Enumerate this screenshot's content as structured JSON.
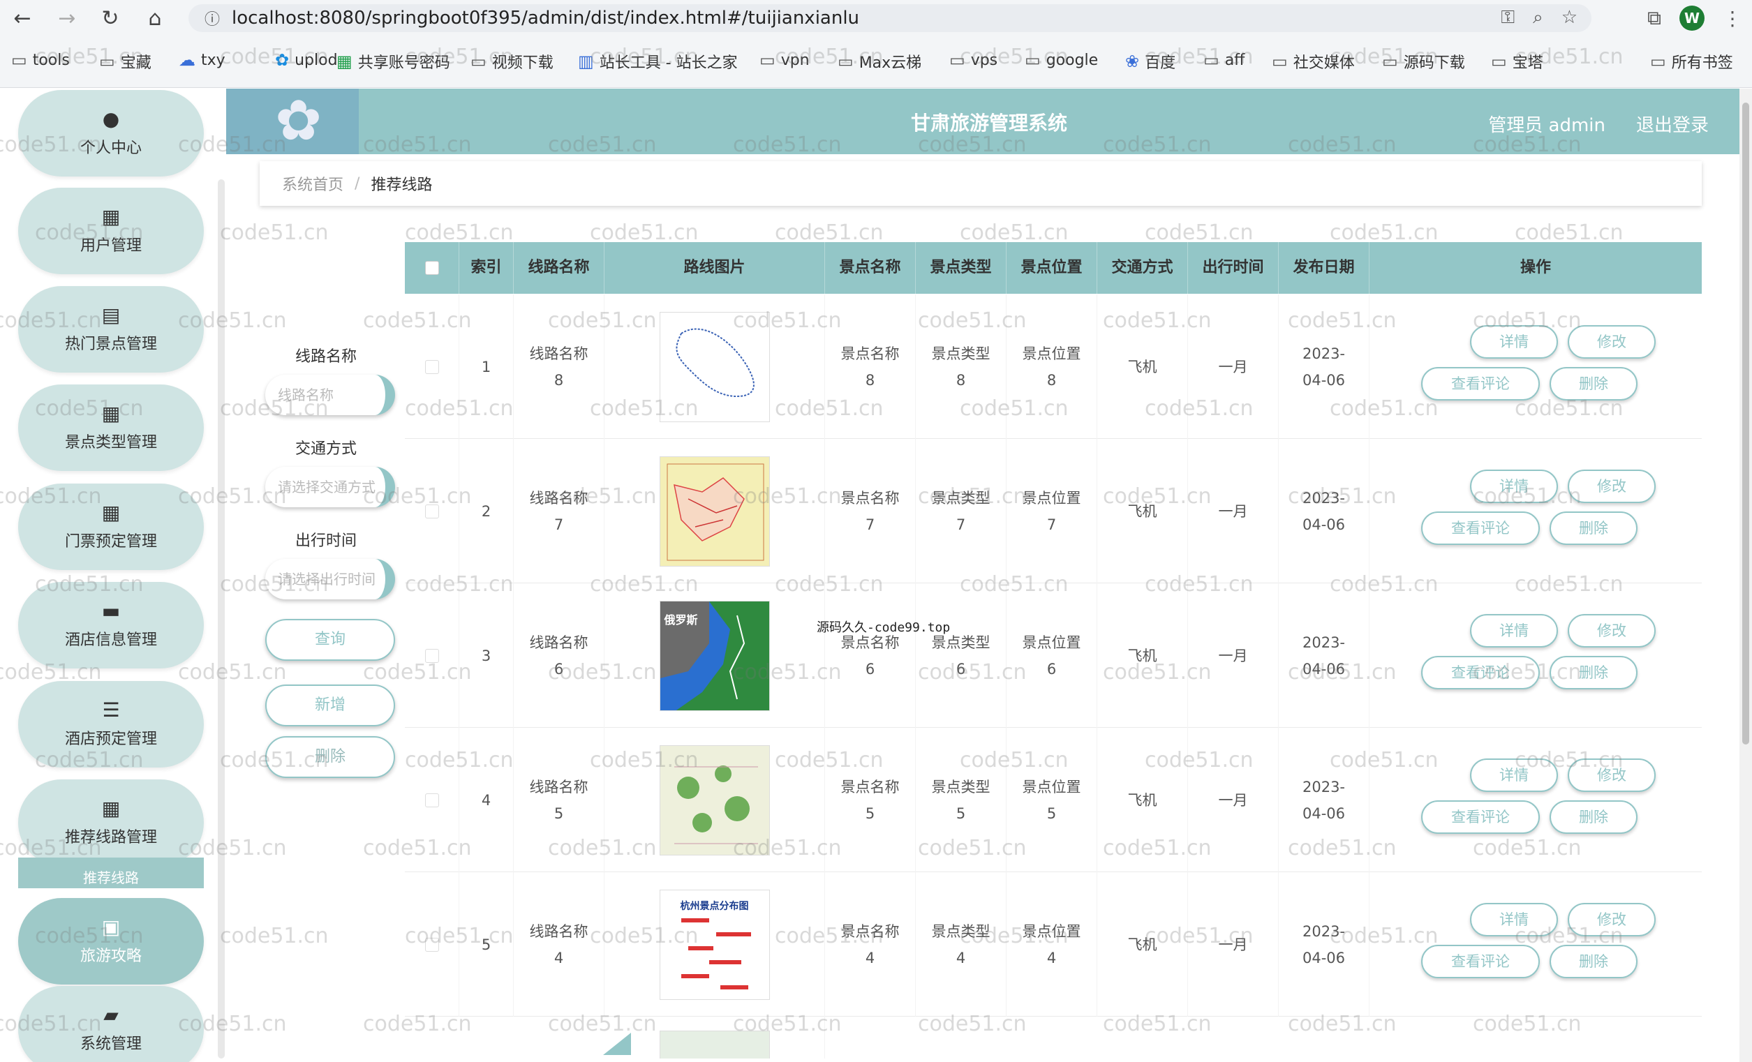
{
  "browser": {
    "url": "localhost:8080/springboot0f395/admin/dist/index.html#/tuijianxianlu",
    "profile_initial": "W",
    "bookmarks": [
      "tools",
      "宝藏",
      "txy",
      "uplod",
      "共享账号密码",
      "视频下载",
      "站长工具 - 站长之家",
      "vpn",
      "Max云梯",
      "vps",
      "google",
      "百度",
      "aff",
      "社交媒体",
      "源码下载",
      "宝塔",
      "所有书签"
    ]
  },
  "header": {
    "title": "甘肃旅游管理系统",
    "user": "管理员 admin",
    "logout": "退出登录"
  },
  "sidebar": {
    "items": [
      {
        "label": "个人中心",
        "icon": "user-icon"
      },
      {
        "label": "用户管理",
        "icon": "grid-icon"
      },
      {
        "label": "热门景点管理",
        "icon": "clipboard-icon"
      },
      {
        "label": "景点类型管理",
        "icon": "grid-icon"
      },
      {
        "label": "门票预定管理",
        "icon": "grid-icon"
      },
      {
        "label": "酒店信息管理",
        "icon": "store-icon"
      },
      {
        "label": "酒店预定管理",
        "icon": "list-icon"
      },
      {
        "label": "推荐线路管理",
        "icon": "grid-icon"
      },
      {
        "label": "旅游攻略",
        "icon": "lock-icon"
      },
      {
        "label": "系统管理",
        "icon": "briefcase-icon"
      }
    ],
    "sub_item": "推荐线路"
  },
  "breadcrumb": {
    "home": "系统首页",
    "current": "推荐线路"
  },
  "filters": {
    "route_name_label": "线路名称",
    "route_name_placeholder": "线路名称",
    "transport_label": "交通方式",
    "transport_placeholder": "请选择交通方式",
    "travel_time_label": "出行时间",
    "travel_time_placeholder": "请选择出行时间",
    "query_button": "查询",
    "add_button": "新增",
    "delete_button": "删除"
  },
  "table": {
    "columns": [
      "索引",
      "线路名称",
      "路线图片",
      "景点名称",
      "景点类型",
      "景点位置",
      "交通方式",
      "出行时间",
      "发布日期",
      "操作"
    ],
    "rows": [
      {
        "index": "1",
        "name": "线路名称8",
        "spot_name": "景点名称8",
        "spot_type": "景点类型8",
        "spot_loc": "景点位置8",
        "transport": "飞机",
        "time": "一月",
        "date": "2023-04-06"
      },
      {
        "index": "2",
        "name": "线路名称7",
        "spot_name": "景点名称7",
        "spot_type": "景点类型7",
        "spot_loc": "景点位置7",
        "transport": "飞机",
        "time": "一月",
        "date": "2023-04-06"
      },
      {
        "index": "3",
        "name": "线路名称6",
        "spot_name": "景点名称6",
        "spot_type": "景点类型6",
        "spot_loc": "景点位置6",
        "transport": "飞机",
        "time": "一月",
        "date": "2023-04-06"
      },
      {
        "index": "4",
        "name": "线路名称5",
        "spot_name": "景点名称5",
        "spot_type": "景点类型5",
        "spot_loc": "景点位置5",
        "transport": "飞机",
        "time": "一月",
        "date": "2023-04-06"
      },
      {
        "index": "5",
        "name": "线路名称4",
        "spot_name": "景点名称4",
        "spot_type": "景点类型4",
        "spot_loc": "景点位置4",
        "transport": "飞机",
        "time": "一月",
        "date": "2023-04-06"
      }
    ],
    "row_buttons": {
      "detail": "详情",
      "edit": "修改",
      "comments": "查看评论",
      "delete": "删除"
    },
    "thumb_caption_5": "杭州景点分布图",
    "thumb_caption_3": "俄罗斯"
  },
  "overlay_text": "源码久久-code99.top",
  "watermark": "code51.cn",
  "colors": {
    "accent": "#93c6c7",
    "sidebar_item": "#cfe4e3"
  }
}
